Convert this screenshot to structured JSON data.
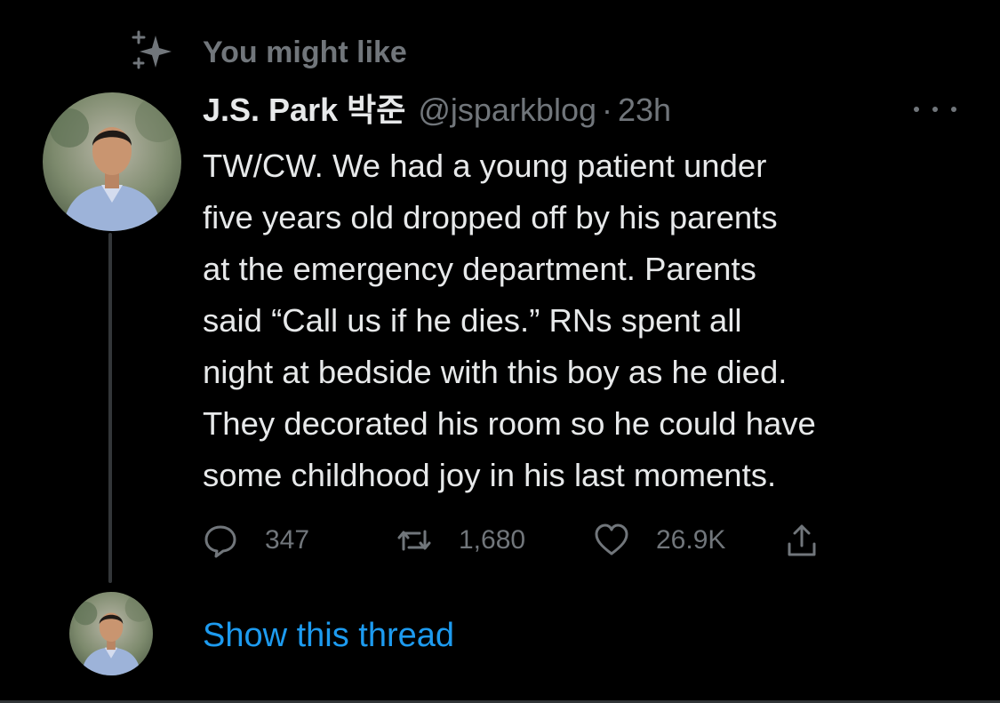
{
  "context": {
    "label": "You might like",
    "icon": "sparkle-icon"
  },
  "tweet": {
    "display_name": "J.S. Park 박준",
    "handle": "@jsparkblog",
    "separator": "·",
    "time": "23h",
    "text": "TW/CW. We had a young patient under\nfive years old dropped off by his parents\nat the emergency department. Parents\nsaid “Call us if he dies.” RNs spent all\nnight at bedside with this boy as he died.\nThey decorated his room so he could have\nsome childhood joy in his last moments.",
    "actions": {
      "replies": "347",
      "retweets": "1,680",
      "likes": "26.9K"
    }
  },
  "thread": {
    "link_label": "Show this thread"
  },
  "colors": {
    "background": "#000000",
    "primary_text": "#e7e9ea",
    "secondary_text": "#71767b",
    "link": "#1d9bf0"
  }
}
